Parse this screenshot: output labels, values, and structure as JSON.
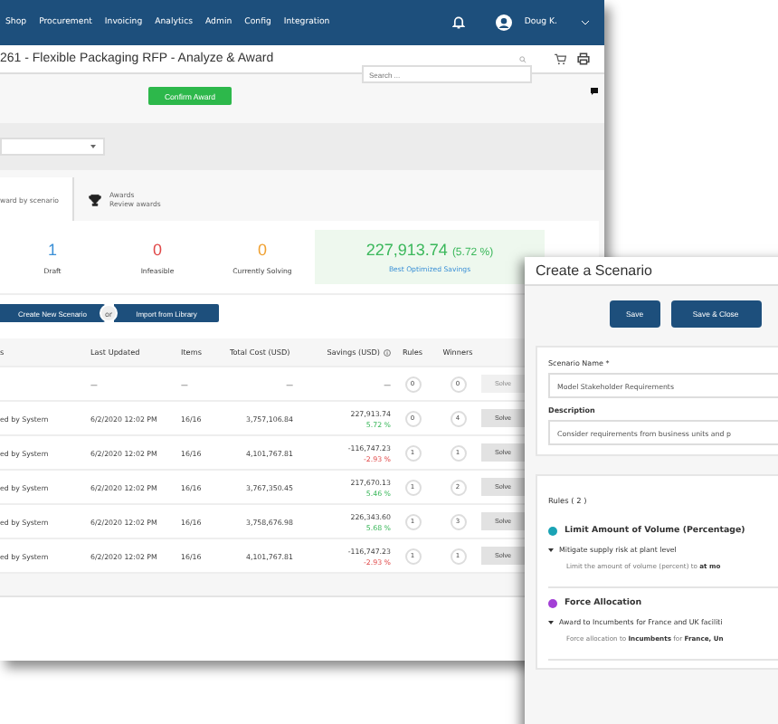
{
  "nav": {
    "items": [
      "Shop",
      "Procurement",
      "Invoicing",
      "Analytics",
      "Admin",
      "Config",
      "Integration"
    ],
    "user": "Doug K."
  },
  "header": {
    "title": "261 - Flexible Packaging RFP - Analyze & Award",
    "search": {
      "placeholder": "Search ..."
    }
  },
  "confirm_button": "Confirm Award",
  "tabs": [
    {
      "title": "ward by scenario",
      "selected": true,
      "kind": "plain"
    },
    {
      "title": "Awards",
      "subtitle": "Review awards",
      "selected": false,
      "kind": "trophy"
    }
  ],
  "stats": [
    {
      "value": "1",
      "label": "Draft",
      "color": "#3a8fd6"
    },
    {
      "value": "0",
      "label": "Infeasible",
      "color": "#e04848"
    },
    {
      "value": "0",
      "label": "Currently Solving",
      "color": "#f0a030"
    }
  ],
  "best": {
    "value": "227,913.74",
    "percent": "(5.72 %)",
    "label": "Best Optimized Savings"
  },
  "actions": {
    "create": "Create New Scenario",
    "or": "or",
    "import": "Import from Library"
  },
  "table": {
    "columns": [
      "s",
      "Last Updated",
      "Items",
      "Total Cost (USD)",
      "Savings (USD)",
      "Rules",
      "Winners"
    ],
    "rows": [
      {
        "name": "",
        "updated": "—",
        "items": "—",
        "total": "—",
        "savings": "—",
        "rules": "0",
        "winners": "0",
        "solve": "Solve",
        "disabled": true
      },
      {
        "name": "ed by System",
        "updated": "6/2/2020 12:02 PM",
        "items": "16/16",
        "total": "3,757,106.84",
        "savings": "227,913.74",
        "percent": "5.72 %",
        "positive": true,
        "rules": "0",
        "winners": "4",
        "solve": "Solve",
        "disabled": false
      },
      {
        "name": "ed by System",
        "updated": "6/2/2020 12:02 PM",
        "items": "16/16",
        "total": "4,101,767.81",
        "savings": "-116,747.23",
        "percent": "-2.93 %",
        "positive": false,
        "rules": "1",
        "winners": "1",
        "solve": "Solve",
        "disabled": false
      },
      {
        "name": "ed by System",
        "updated": "6/2/2020 12:02 PM",
        "items": "16/16",
        "total": "3,767,350.45",
        "savings": "217,670.13",
        "percent": "5.46 %",
        "positive": true,
        "rules": "1",
        "winners": "2",
        "solve": "Solve",
        "disabled": false
      },
      {
        "name": "ed by System",
        "updated": "6/2/2020 12:02 PM",
        "items": "16/16",
        "total": "3,758,676.98",
        "savings": "226,343.60",
        "percent": "5.68 %",
        "positive": true,
        "rules": "1",
        "winners": "3",
        "solve": "Solve",
        "disabled": false
      },
      {
        "name": "ed by System",
        "updated": "6/2/2020 12:02 PM",
        "items": "16/16",
        "total": "4,101,767.81",
        "savings": "-116,747.23",
        "percent": "-2.93 %",
        "positive": false,
        "rules": "1",
        "winners": "1",
        "solve": "Solve",
        "disabled": false
      }
    ]
  },
  "dialog": {
    "title": "Create a Scenario",
    "buttons": [
      "Save",
      "Save & Close"
    ],
    "name_label": "Scenario Name *",
    "name_value": "Model Stakeholder Requirements",
    "desc_label": "Description",
    "desc_value": "Consider requirements from business units and p",
    "rules_label": "Rules ( 2 )",
    "rules": [
      {
        "title": "Limit Amount of Volume (Percentage)",
        "color": "#1aa3b5",
        "subtitle": "Mitigate supply risk at plant level",
        "detail": "Limit the amount of volume (percent) to **at mo**"
      },
      {
        "title": "Force Allocation",
        "color": "#a33fd6",
        "subtitle": "Award to Incumbents for France and UK faciliti",
        "detail": "Force allocation to **Incumbents** for **France, Un**"
      }
    ]
  }
}
